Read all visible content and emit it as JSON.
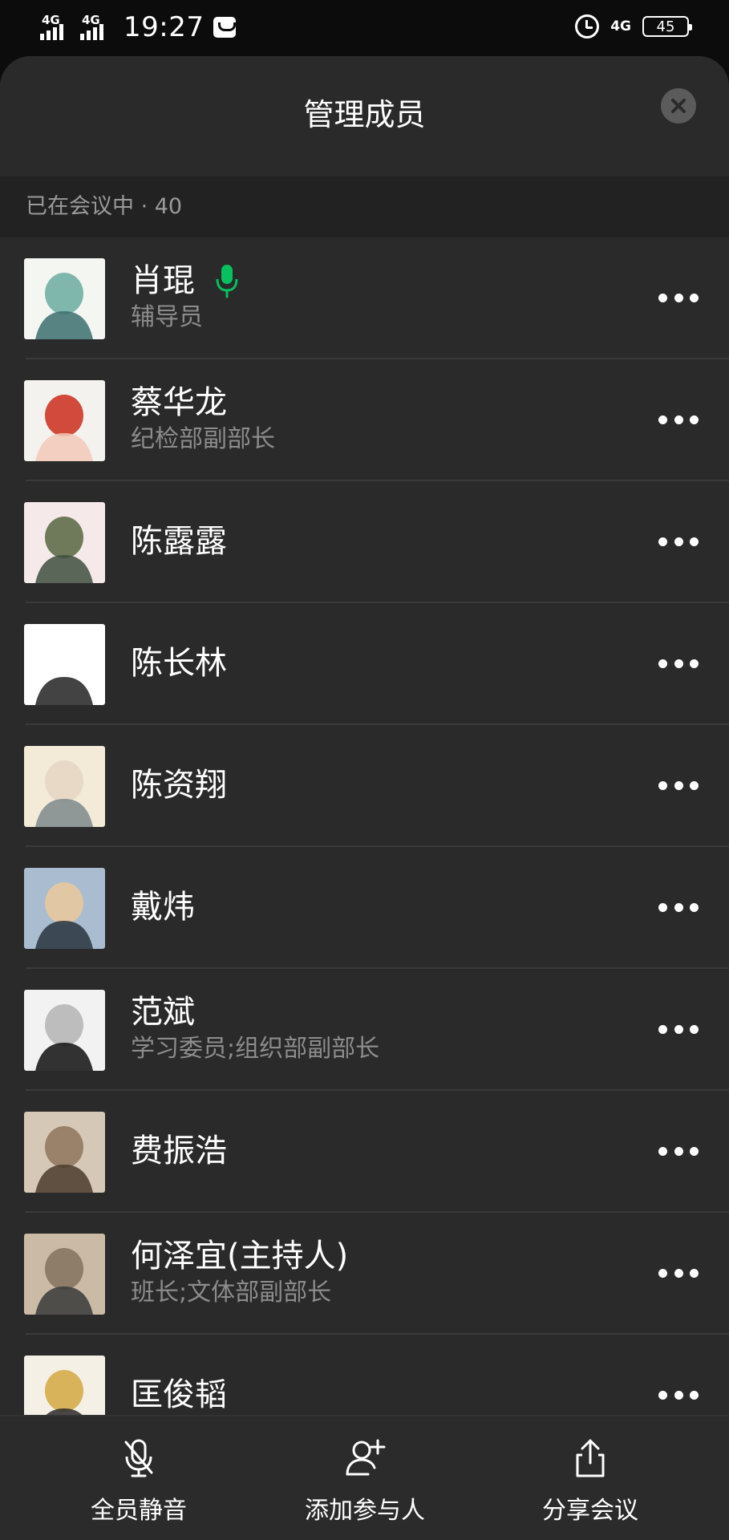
{
  "status_bar": {
    "signal1": "4G",
    "signal2": "4G",
    "time": "19:27",
    "network": "4G",
    "battery": "45"
  },
  "header": {
    "title": "管理成员"
  },
  "section": {
    "label": "已在会议中 · 40"
  },
  "members": [
    {
      "name": "肖琨",
      "role": "辅导员",
      "speaking": true,
      "avatar_colors": [
        "#f4f6f2",
        "#7fb7ad",
        "#3c6e70"
      ]
    },
    {
      "name": "蔡华龙",
      "role": "纪检部副部长",
      "speaking": false,
      "avatar_colors": [
        "#f4f2ee",
        "#d24a3c",
        "#f2c9b8"
      ]
    },
    {
      "name": "陈露露",
      "role": "",
      "speaking": false,
      "avatar_colors": [
        "#f6e9ea",
        "#6f7a5a",
        "#3e4f3d"
      ]
    },
    {
      "name": "陈长林",
      "role": "",
      "speaking": false,
      "avatar_colors": [
        "#ffffff",
        "#ffffff",
        "#222222"
      ]
    },
    {
      "name": "陈资翔",
      "role": "",
      "speaking": false,
      "avatar_colors": [
        "#f3ead8",
        "#e7d9c6",
        "#7d8a8c"
      ]
    },
    {
      "name": "戴炜",
      "role": "",
      "speaking": false,
      "avatar_colors": [
        "#a9bcd0",
        "#e1c7a3",
        "#2a3440"
      ]
    },
    {
      "name": "范斌",
      "role": "学习委员;组织部副部长",
      "speaking": false,
      "avatar_colors": [
        "#f2f2f2",
        "#bdbdbd",
        "#111111"
      ]
    },
    {
      "name": "费振浩",
      "role": "",
      "speaking": false,
      "avatar_colors": [
        "#d6c8b6",
        "#9a8169",
        "#4a3b2e"
      ]
    },
    {
      "name": "何泽宜(主持人)",
      "role": "班长;文体部副部长",
      "speaking": false,
      "avatar_colors": [
        "#cbbba6",
        "#8e7d68",
        "#3a3a3a"
      ]
    },
    {
      "name": "匡俊韬",
      "role": "",
      "speaking": false,
      "avatar_colors": [
        "#f4f0e6",
        "#d8b35a",
        "#2a2a2a"
      ]
    }
  ],
  "toolbar": {
    "mute_all": "全员静音",
    "add_participant": "添加参与人",
    "share_meeting": "分享会议"
  },
  "icons": {
    "close": "close-icon",
    "more": "more-icon",
    "mic_active": "microphone-icon",
    "mute": "microphone-off-icon",
    "add_user": "add-user-icon",
    "share": "share-icon"
  },
  "colors": {
    "sheet_bg": "#2a2a2a",
    "section_bg": "#222222",
    "speaking_green": "#07c160",
    "secondary_text": "#8c8c8c"
  }
}
